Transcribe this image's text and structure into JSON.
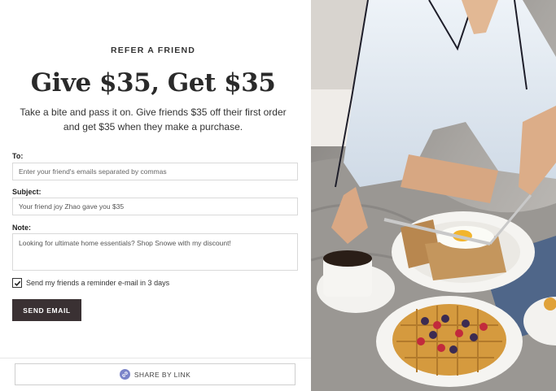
{
  "referral": {
    "eyebrow": "REFER A FRIEND",
    "headline": "Give $35, Get $35",
    "subtitle": "Take a bite and pass it on. Give friends $35 off their first order and get $35 when they make a purchase."
  },
  "form": {
    "to_label": "To:",
    "to_placeholder": "Enter your friend's emails separated by commas",
    "subject_label": "Subject:",
    "subject_value": "Your friend joy Zhao gave you $35",
    "note_label": "Note:",
    "note_value": "Looking for ultimate home essentials? Shop Snowe with my discount!",
    "reminder_label": "Send my friends a reminder e-mail in 3 days",
    "reminder_checked": true,
    "send_label": "SEND EMAIL"
  },
  "share": {
    "label": "SHARE BY LINK",
    "icon": "link-icon"
  },
  "hero_image": {
    "description_icon": "breakfast-photo",
    "accent": "#3a3133",
    "link_icon_color": "#7b84c9"
  }
}
